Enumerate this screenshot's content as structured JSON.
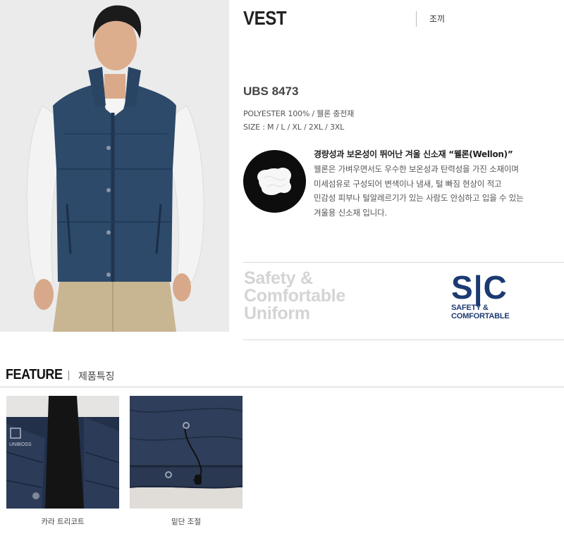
{
  "product": {
    "title": "VEST",
    "subtitle": "조끼",
    "code": "UBS 8473",
    "material": "POLYESTER 100% / 웰론 충전재",
    "sizes": "SIZE : M / L / XL / 2XL / 3XL"
  },
  "fiber": {
    "title": "경량성과 보온성이 뛰어난 겨울 신소재 “웰론(Wellon)”",
    "lines": [
      "웰론은 가벼우면서도 우수한 보온성과 탄력성을 가진 소재이며",
      "미세섬유로 구성되어 변색이나 냄새, 털 빠짐 현상이 적고",
      "민감성 피부나 털알레르기가 있는 사람도 안심하고 입을 수 있는",
      "겨울용 신소재 입니다."
    ]
  },
  "tagline": {
    "line1": "Safety &",
    "line2": "Comfortable",
    "line3": "Uniform"
  },
  "logo": {
    "letters": "S|C",
    "sub1": "SAFETY &",
    "sub2": "COMFORTABLE",
    "color": "#1c3a72"
  },
  "feature": {
    "label": "FEATURE",
    "sublabel": "제품특징",
    "items": [
      {
        "caption": "카라 트리코트",
        "icon": "collar-detail-photo"
      },
      {
        "caption": "밑단 조절",
        "icon": "hem-drawcord-photo"
      }
    ]
  },
  "brand_tag": "UNIBOSS"
}
